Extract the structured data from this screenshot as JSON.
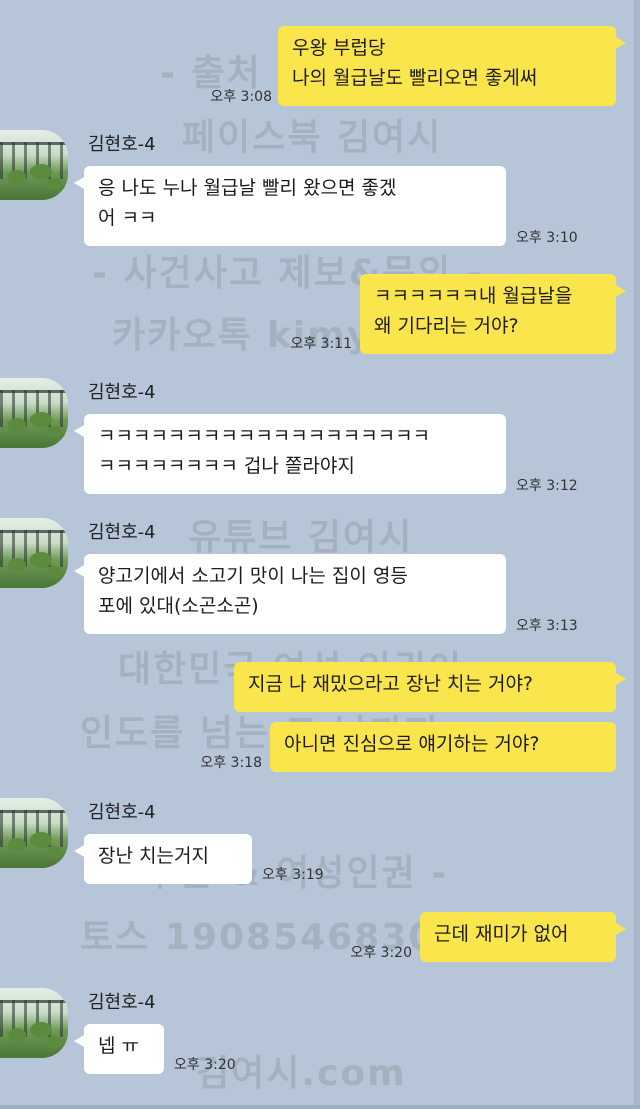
{
  "contact_name": "김현호-4",
  "messages": [
    {
      "side": "me",
      "text": "우왕 부럽당\n나의 월급날도 빨리오면 좋게써",
      "time": "오후 3:08"
    },
    {
      "side": "other",
      "text": "응 나도 누나 월급날 빨리 왔으면 좋겠\n어 ㅋㅋ",
      "time": "오후 3:10"
    },
    {
      "side": "me",
      "text": "ㅋㅋㅋㅋㅋㅋ내 월급날을\n왜 기다리는 거야?",
      "time": "오후 3:11"
    },
    {
      "side": "other",
      "text": "ㅋㅋㅋㅋㅋㅋㅋㅋㅋㅋㅋㅋㅋㅋㅋㅋㅋㅋㅋ\nㅋㅋㅋㅋㅋㅋㅋㅋ 겁나 쫄라야지",
      "time": "오후 3:12"
    },
    {
      "side": "other",
      "text": "양고기에서 소고기 맛이 나는 집이 영등\n포에 있대(소곤소곤)",
      "time": "오후 3:13"
    },
    {
      "side": "me",
      "text": "지금 나 재밌으라고 장난 치는 거야?",
      "time": ""
    },
    {
      "side": "me",
      "text": "아니면 진심으로 얘기하는 거야?",
      "time": "오후 3:18"
    },
    {
      "side": "other",
      "text": "장난 치는거지",
      "time": "오후 3:19"
    },
    {
      "side": "me",
      "text": "근데 재미가 없어",
      "time": "오후 3:20"
    },
    {
      "side": "other",
      "text": "넵 ㅠ",
      "time": "오후 3:20"
    }
  ],
  "watermarks": [
    "- 출처 & 문의 -",
    "페이스북 김여시",
    "- 사건사고 제보&문의 -",
    "카카오톡 kimyeosi",
    "유튜브",
    "유튜브 김여시",
    "대한민국 여성 인권이",
    "인도를 넘는 그 날까지",
    "- 후원 & 여성인권 -",
    "토스 190854683007",
    "김여시.com"
  ]
}
